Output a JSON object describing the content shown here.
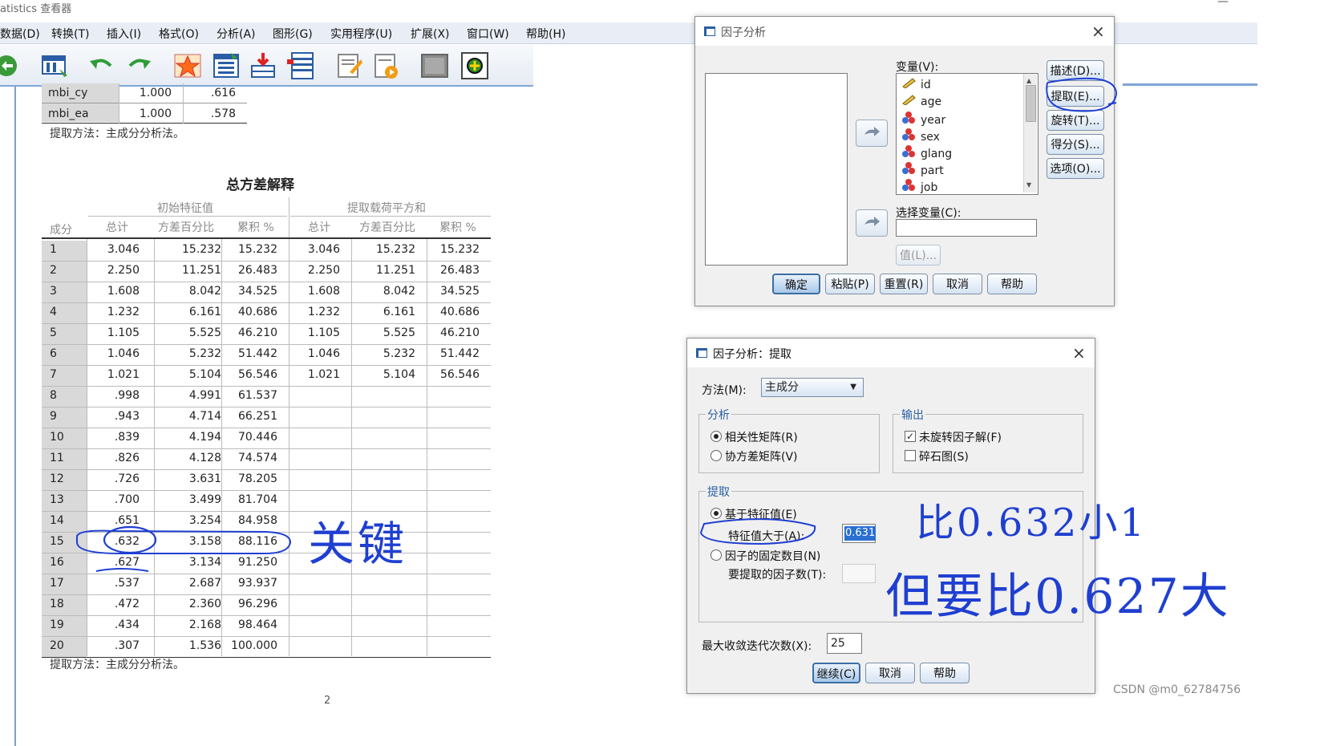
{
  "app": {
    "title": "atistics 查看器",
    "minimize": "—"
  },
  "menu": [
    "数据(D)",
    "转换(T)",
    "插入(I)",
    "格式(O)",
    "分析(A)",
    "图形(G)",
    "实用程序(U)",
    "扩展(X)",
    "窗口(W)",
    "帮助(H)"
  ],
  "toolbar_icons": [
    "open-icon",
    "data-editor-icon",
    "undo-icon",
    "redo-icon",
    "goto-case-icon",
    "goto-variable-icon",
    "insert-icon",
    "variables-icon",
    "output-icon",
    "script-icon",
    "grey-icon",
    "designate-icon"
  ],
  "comm_table": {
    "rows": [
      {
        "name": "mbi_cy",
        "initial": "1.000",
        "extract": ".616"
      },
      {
        "name": "mbi_ea",
        "initial": "1.000",
        "extract": ".578"
      }
    ],
    "note": "提取方法：主成分分析法。"
  },
  "variance_table": {
    "title": "总方差解释",
    "group_initial": "初始特征值",
    "group_extract": "提取载荷平方和",
    "col_component": "成分",
    "col_total": "总计",
    "col_pct": "方差百分比",
    "col_cum": "累积 %",
    "rows": [
      [
        "1",
        "3.046",
        "15.232",
        "15.232",
        "3.046",
        "15.232",
        "15.232"
      ],
      [
        "2",
        "2.250",
        "11.251",
        "26.483",
        "2.250",
        "11.251",
        "26.483"
      ],
      [
        "3",
        "1.608",
        "8.042",
        "34.525",
        "1.608",
        "8.042",
        "34.525"
      ],
      [
        "4",
        "1.232",
        "6.161",
        "40.686",
        "1.232",
        "6.161",
        "40.686"
      ],
      [
        "5",
        "1.105",
        "5.525",
        "46.210",
        "1.105",
        "5.525",
        "46.210"
      ],
      [
        "6",
        "1.046",
        "5.232",
        "51.442",
        "1.046",
        "5.232",
        "51.442"
      ],
      [
        "7",
        "1.021",
        "5.104",
        "56.546",
        "1.021",
        "5.104",
        "56.546"
      ],
      [
        "8",
        ".998",
        "4.991",
        "61.537",
        "",
        "",
        ""
      ],
      [
        "9",
        ".943",
        "4.714",
        "66.251",
        "",
        "",
        ""
      ],
      [
        "10",
        ".839",
        "4.194",
        "70.446",
        "",
        "",
        ""
      ],
      [
        "11",
        ".826",
        "4.128",
        "74.574",
        "",
        "",
        ""
      ],
      [
        "12",
        ".726",
        "3.631",
        "78.205",
        "",
        "",
        ""
      ],
      [
        "13",
        ".700",
        "3.499",
        "81.704",
        "",
        "",
        ""
      ],
      [
        "14",
        ".651",
        "3.254",
        "84.958",
        "",
        "",
        ""
      ],
      [
        "15",
        ".632",
        "3.158",
        "88.116",
        "",
        "",
        ""
      ],
      [
        "16",
        ".627",
        "3.134",
        "91.250",
        "",
        "",
        ""
      ],
      [
        "17",
        ".537",
        "2.687",
        "93.937",
        "",
        "",
        ""
      ],
      [
        "18",
        ".472",
        "2.360",
        "96.296",
        "",
        "",
        ""
      ],
      [
        "19",
        ".434",
        "2.168",
        "98.464",
        "",
        "",
        ""
      ],
      [
        "20",
        ".307",
        "1.536",
        "100.000",
        "",
        "",
        ""
      ]
    ],
    "note": "提取方法：主成分分析法。",
    "page_marker": "2"
  },
  "factor_dialog": {
    "title": "因子分析",
    "variables_label": "变量(V):",
    "variables": [
      "id",
      "age",
      "year",
      "sex",
      "glang",
      "part",
      "job"
    ],
    "selection_label": "选择变量(C):",
    "value_button": "值(L)...",
    "side_buttons": [
      "描述(D)...",
      "提取(E)...",
      "旋转(T)...",
      "得分(S)...",
      "选项(O)..."
    ],
    "bottom_buttons": [
      "确定",
      "粘贴(P)",
      "重置(R)",
      "取消",
      "帮助"
    ]
  },
  "extract_dialog": {
    "title": "因子分析：提取",
    "method_label": "方法(M):",
    "method_value": "主成分",
    "analysis_group": "分析",
    "analysis_options": [
      "相关性矩阵(R)",
      "协方差矩阵(V)"
    ],
    "output_group": "输出",
    "output_options": [
      "未旋转因子解(F)",
      "碎石图(S)"
    ],
    "output_checked": [
      true,
      false
    ],
    "extract_group": "提取",
    "eigen_option": "基于特征值(E)",
    "eigen_label": "特征值大于(A):",
    "eigen_value": "0.631",
    "fixed_option": "因子的固定数目(N)",
    "fixed_label": "要提取的因子数(T):",
    "fixed_value": "",
    "maxiter_label": "最大收敛迭代次数(X):",
    "maxiter_value": "25",
    "buttons": [
      "继续(C)",
      "取消",
      "帮助"
    ]
  },
  "annotations": {
    "handwriting_1": "关键",
    "handwriting_2": "比0.632小1",
    "handwriting_3": "但要比0.627大"
  },
  "watermark": "CSDN @m0_62784756",
  "colors": {
    "ink": "#1f3fd1",
    "menubar": "#e9eef6",
    "dialog": "#f0f0f0",
    "accent": "#3a6ea5"
  }
}
